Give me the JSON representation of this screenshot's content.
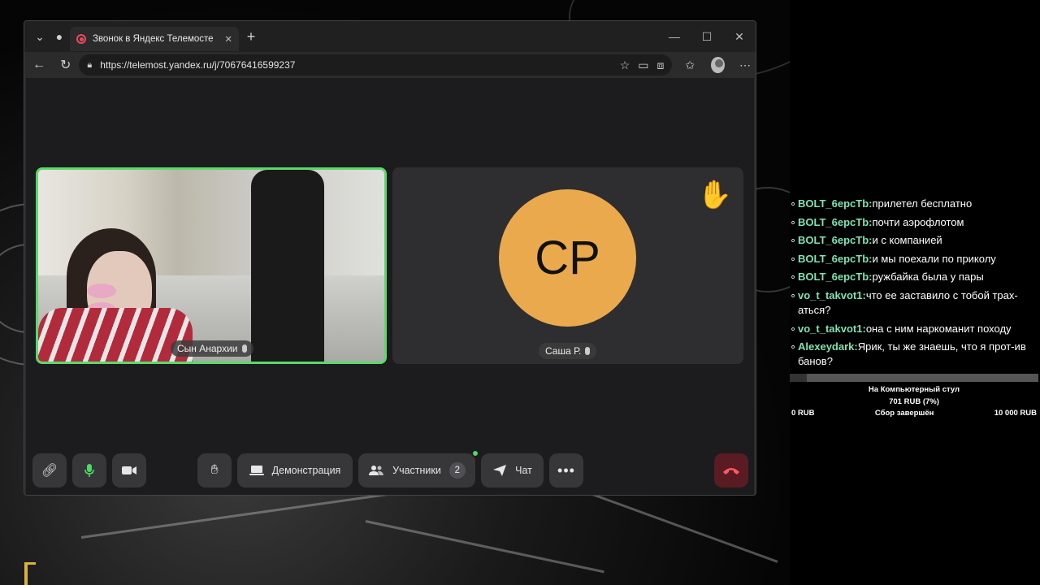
{
  "browser": {
    "tab_title": "Звонок в Яндекс Телемосте",
    "url": "https://telemost.yandex.ru/j/70676416599237"
  },
  "call": {
    "participants": [
      {
        "name": "Сын Анархии"
      },
      {
        "name": "Саша Р.",
        "initials": "СР",
        "hand_raised": true
      }
    ],
    "controls": {
      "demo_label": "Демонстрация",
      "participants_label": "Участники",
      "participants_count": "2",
      "chat_label": "Чат"
    }
  },
  "chat": {
    "messages": [
      {
        "nick": "BOLT_6ерсТb:",
        "text": "прилетел бесплатно"
      },
      {
        "nick": "BOLT_6ерсТb:",
        "text": "почти аэрофлотом"
      },
      {
        "nick": "BOLT_6ерсТb:",
        "text": "и с компанией"
      },
      {
        "nick": "BOLT_6ерсТb:",
        "text": "и мы поехали по приколу"
      },
      {
        "nick": "BOLT_6ерсТb:",
        "text": "ружбайка была у пары"
      },
      {
        "nick": "vo_t_takvot1:",
        "text": "что ее заставило с тобой трах-аться?"
      },
      {
        "nick": "vo_t_takvot1:",
        "text": "она с ним наркоманит походу"
      },
      {
        "nick": "Alexeydark:",
        "text": "Ярик, ты же знаешь, что я прот-ив банов?"
      }
    ]
  },
  "donation": {
    "title": "На Компьютерный стул",
    "amount": "701 RUB (7%)",
    "progress": 0.07,
    "min_label": "0 RUB",
    "status": "Сбор завершён",
    "max_label": "10 000 RUB"
  }
}
